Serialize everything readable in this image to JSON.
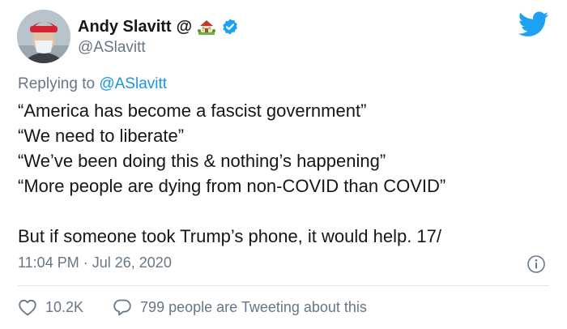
{
  "author": {
    "display_name": "Andy Slavitt",
    "at_symbol": "@",
    "handle": "@ASlavitt",
    "icons": [
      "house-with-garden-icon",
      "verified-badge-icon"
    ]
  },
  "reply": {
    "prefix": "Replying to",
    "mention": "@ASlavitt"
  },
  "body": {
    "lines": [
      "“America has become a fascist government”",
      "“We need to liberate”",
      "“We’ve been doing this & nothing’s happening”",
      "“More people are dying from non-COVID than COVID”"
    ],
    "closing": "But if someone took Trump’s phone, it would help. 17/"
  },
  "meta": {
    "time": "11:04 PM",
    "separator": "·",
    "date": "Jul 26, 2020"
  },
  "actions": {
    "like_count": "10.2K",
    "tweeting_text": "799 people are Tweeting about this"
  },
  "colors": {
    "brand": "#1da1f2",
    "muted": "#657786",
    "link": "#1b95e0",
    "text": "#14171a"
  }
}
